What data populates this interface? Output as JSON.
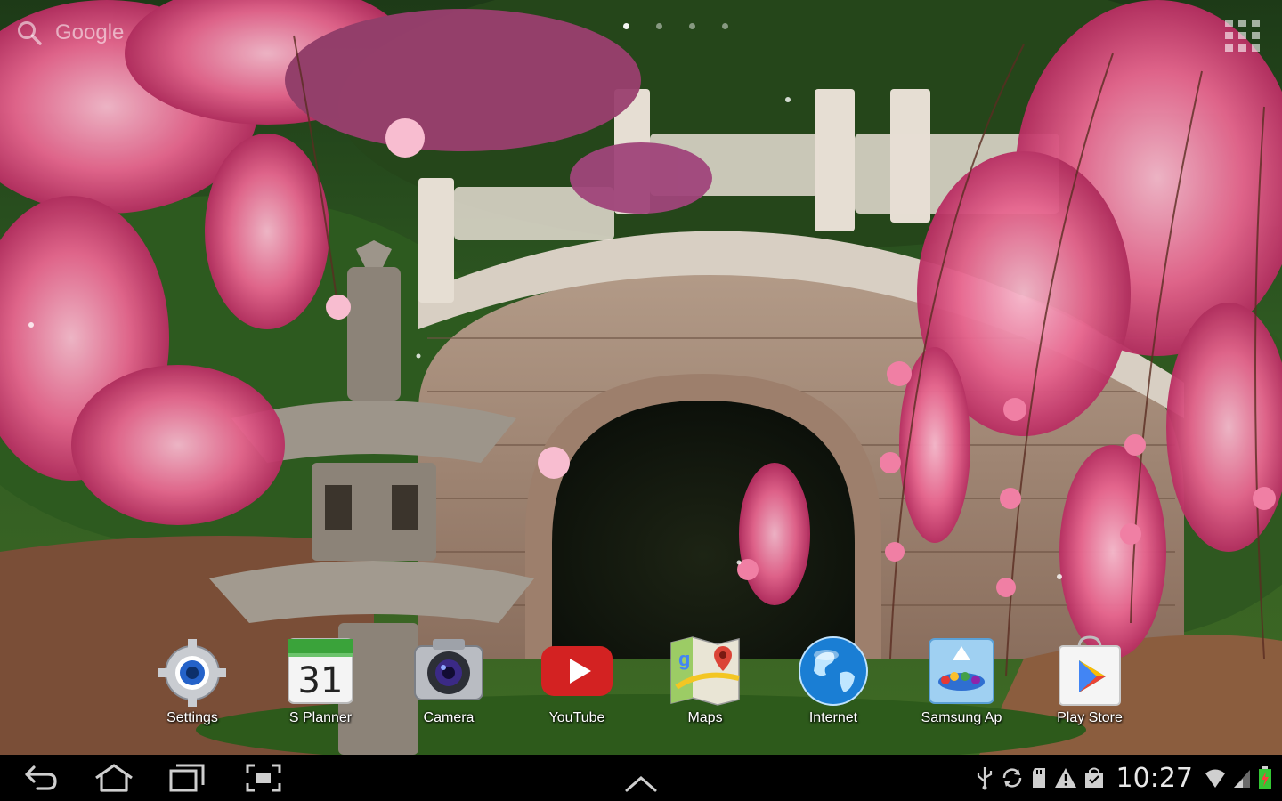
{
  "search": {
    "label": "Google"
  },
  "page_indicator": {
    "count": 4,
    "active_index": 0
  },
  "dock_apps": [
    {
      "label": "Settings"
    },
    {
      "label": "S Planner",
      "date": "31"
    },
    {
      "label": "Camera"
    },
    {
      "label": "YouTube"
    },
    {
      "label": "Maps"
    },
    {
      "label": "Internet"
    },
    {
      "label": "Samsung Ap"
    },
    {
      "label": "Play Store"
    }
  ],
  "status_bar": {
    "time": "10:27"
  },
  "colors": {
    "navbar": "#000000",
    "blossom": "#e8658f",
    "youtube_red": "#d32222"
  }
}
